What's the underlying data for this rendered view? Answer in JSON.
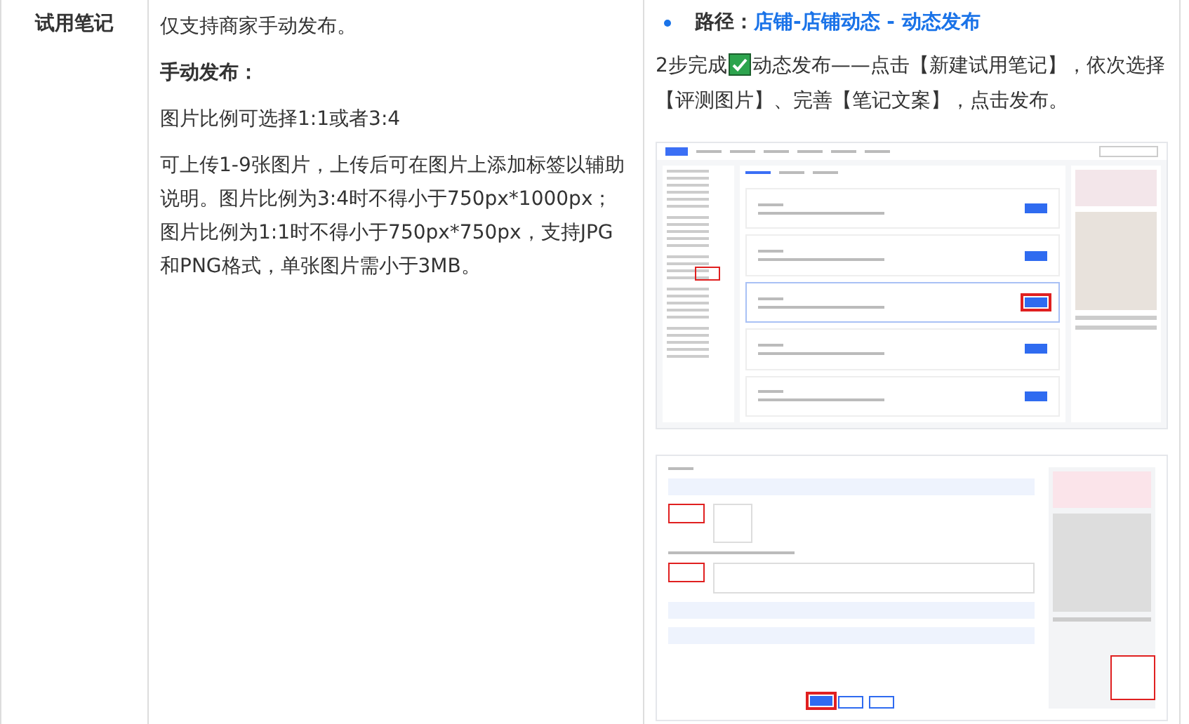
{
  "row": {
    "label": "试用笔记",
    "description": [
      {
        "kind": "text",
        "text": "仅支持商家手动发布。"
      },
      {
        "kind": "heading",
        "text": "手动发布："
      },
      {
        "kind": "text",
        "text": "图片比例可选择1:1或者3:4"
      },
      {
        "kind": "text",
        "text": "可上传1-9张图片，上传后可在图片上添加标签以辅助说明。图片比例为3:4时不得小于750px*1000px；图片比例为1:1时不得小于750px*750px，支持JPG和PNG格式，单张图片需小于3MB。"
      }
    ],
    "path_label": "路径：",
    "path_value": "店铺-店铺动态 - 动态发布",
    "instruction_before": "2步完成",
    "instruction_after": "动态发布——点击【新建试用笔记】，依次选择【评测图片】、完善【笔记文案】，点击发布。"
  }
}
